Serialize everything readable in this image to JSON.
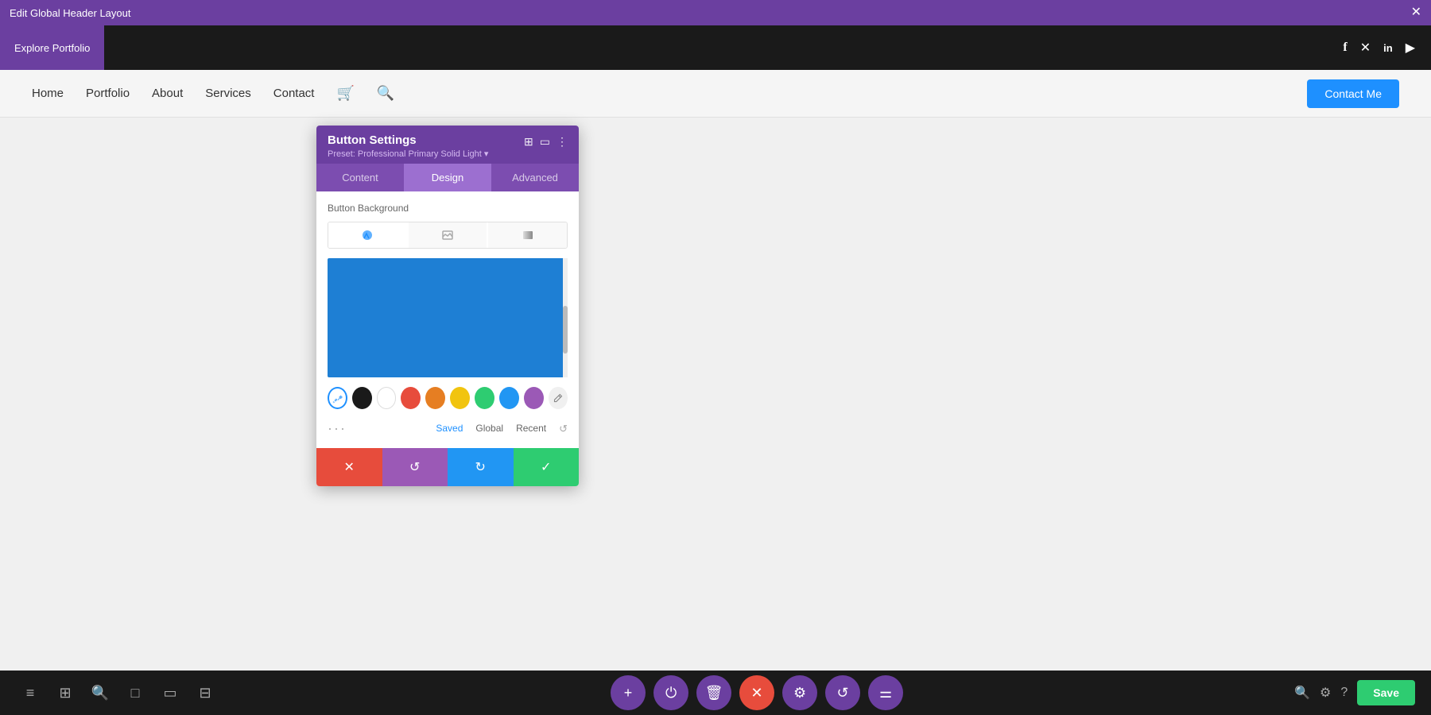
{
  "titleBar": {
    "title": "Edit Global Header Layout",
    "closeIcon": "✕"
  },
  "headerTop": {
    "exploreButton": "Explore Portfolio",
    "socialIcons": [
      {
        "name": "facebook-icon",
        "symbol": "f"
      },
      {
        "name": "twitter-x-icon",
        "symbol": "✕"
      },
      {
        "name": "linkedin-icon",
        "symbol": "in"
      },
      {
        "name": "youtube-icon",
        "symbol": "▶"
      }
    ]
  },
  "nav": {
    "links": [
      "Home",
      "Portfolio",
      "About",
      "Services",
      "Contact"
    ],
    "contactButton": "Contact Me"
  },
  "panel": {
    "title": "Button Settings",
    "preset": "Preset: Professional Primary Solid Light ▾",
    "tabs": [
      "Content",
      "Design",
      "Advanced"
    ],
    "activeTab": "Design",
    "sectionLabel": "Button Background",
    "bgTypes": [
      "color",
      "image",
      "gradient"
    ],
    "colorPreview": "#1e7fd4",
    "swatches": [
      {
        "color": "#1e90ff",
        "active": true
      },
      {
        "color": "#1a1a1a"
      },
      {
        "color": "#ffffff"
      },
      {
        "color": "#e74c3c"
      },
      {
        "color": "#e67e22"
      },
      {
        "color": "#f1c40f"
      },
      {
        "color": "#2ecc71"
      },
      {
        "color": "#2196f3"
      },
      {
        "color": "#9b59b6"
      }
    ],
    "bottomTabs": [
      "Saved",
      "Global",
      "Recent"
    ],
    "activeBottomTab": "Saved",
    "actions": {
      "cancel": "✕",
      "undo": "↺",
      "redo": "↻",
      "confirm": "✓"
    }
  },
  "bottomToolbar": {
    "leftIcons": [
      "≡",
      "⊞",
      "🔍",
      "□",
      "▭",
      "⊟"
    ],
    "centerButtons": [
      {
        "symbol": "+",
        "class": "bc-purple"
      },
      {
        "symbol": "⏻",
        "class": "bc-purple"
      },
      {
        "symbol": "🗑",
        "class": "bc-purple"
      },
      {
        "symbol": "✕",
        "class": "bc-red"
      },
      {
        "symbol": "⚙",
        "class": "bc-purple"
      },
      {
        "symbol": "↺",
        "class": "bc-purple"
      },
      {
        "symbol": "⚌",
        "class": "bc-purple"
      }
    ],
    "rightIcons": [
      "🔍",
      "⚙",
      "?"
    ],
    "saveButton": "Save"
  }
}
